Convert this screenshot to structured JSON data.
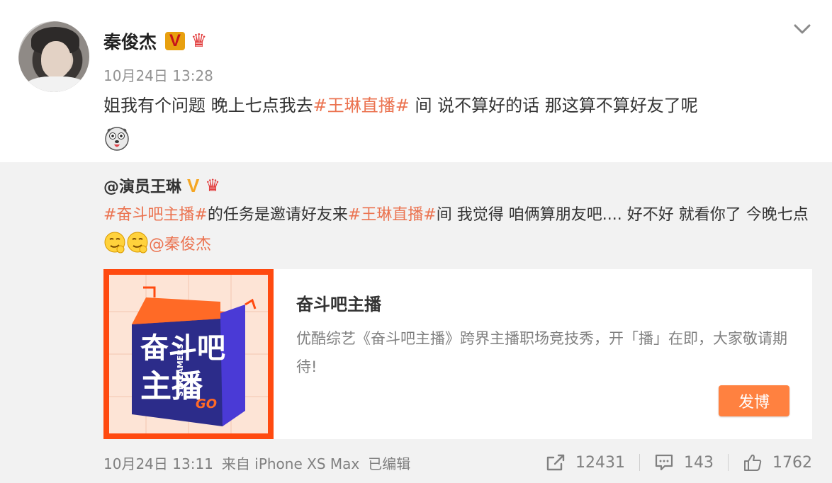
{
  "post": {
    "author": "秦俊杰",
    "verified": "V",
    "time": "10月24日 13:28",
    "text_parts": [
      "姐我有个问题 晚上七点我去",
      "#王琳直播#",
      " 间 说不算好的话  那这算不算好友了呢"
    ]
  },
  "repost": {
    "author": "@演员王琳",
    "verified": "V",
    "text_parts": [
      "#奋斗吧主播#",
      "的任务是邀请好友来",
      "#王琳直播#",
      "间 我觉得 咱俩算朋友吧.... 好不好 就看你了 今晚七点",
      "@秦俊杰"
    ],
    "card": {
      "title": "奋斗吧主播",
      "description": "优酷综艺《奋斗吧主播》跨界主播职场竞技秀，开「播」在即，大家敬请期待!",
      "button": "发博",
      "logo_line1": "奋斗吧",
      "logo_line2": "主播",
      "logo_sub": "STREAMERS",
      "logo_go": "GO"
    },
    "meta": {
      "time": "10月24日 13:11",
      "source": "来自 iPhone XS Max",
      "edited": "已编辑"
    },
    "stats": {
      "reposts": "12431",
      "comments": "143",
      "likes": "1762"
    }
  },
  "colors": {
    "link": "#eb7350",
    "button": "#ff8140",
    "repost_bg": "#f2f2f2",
    "badge_gold": "#e8a00f"
  }
}
